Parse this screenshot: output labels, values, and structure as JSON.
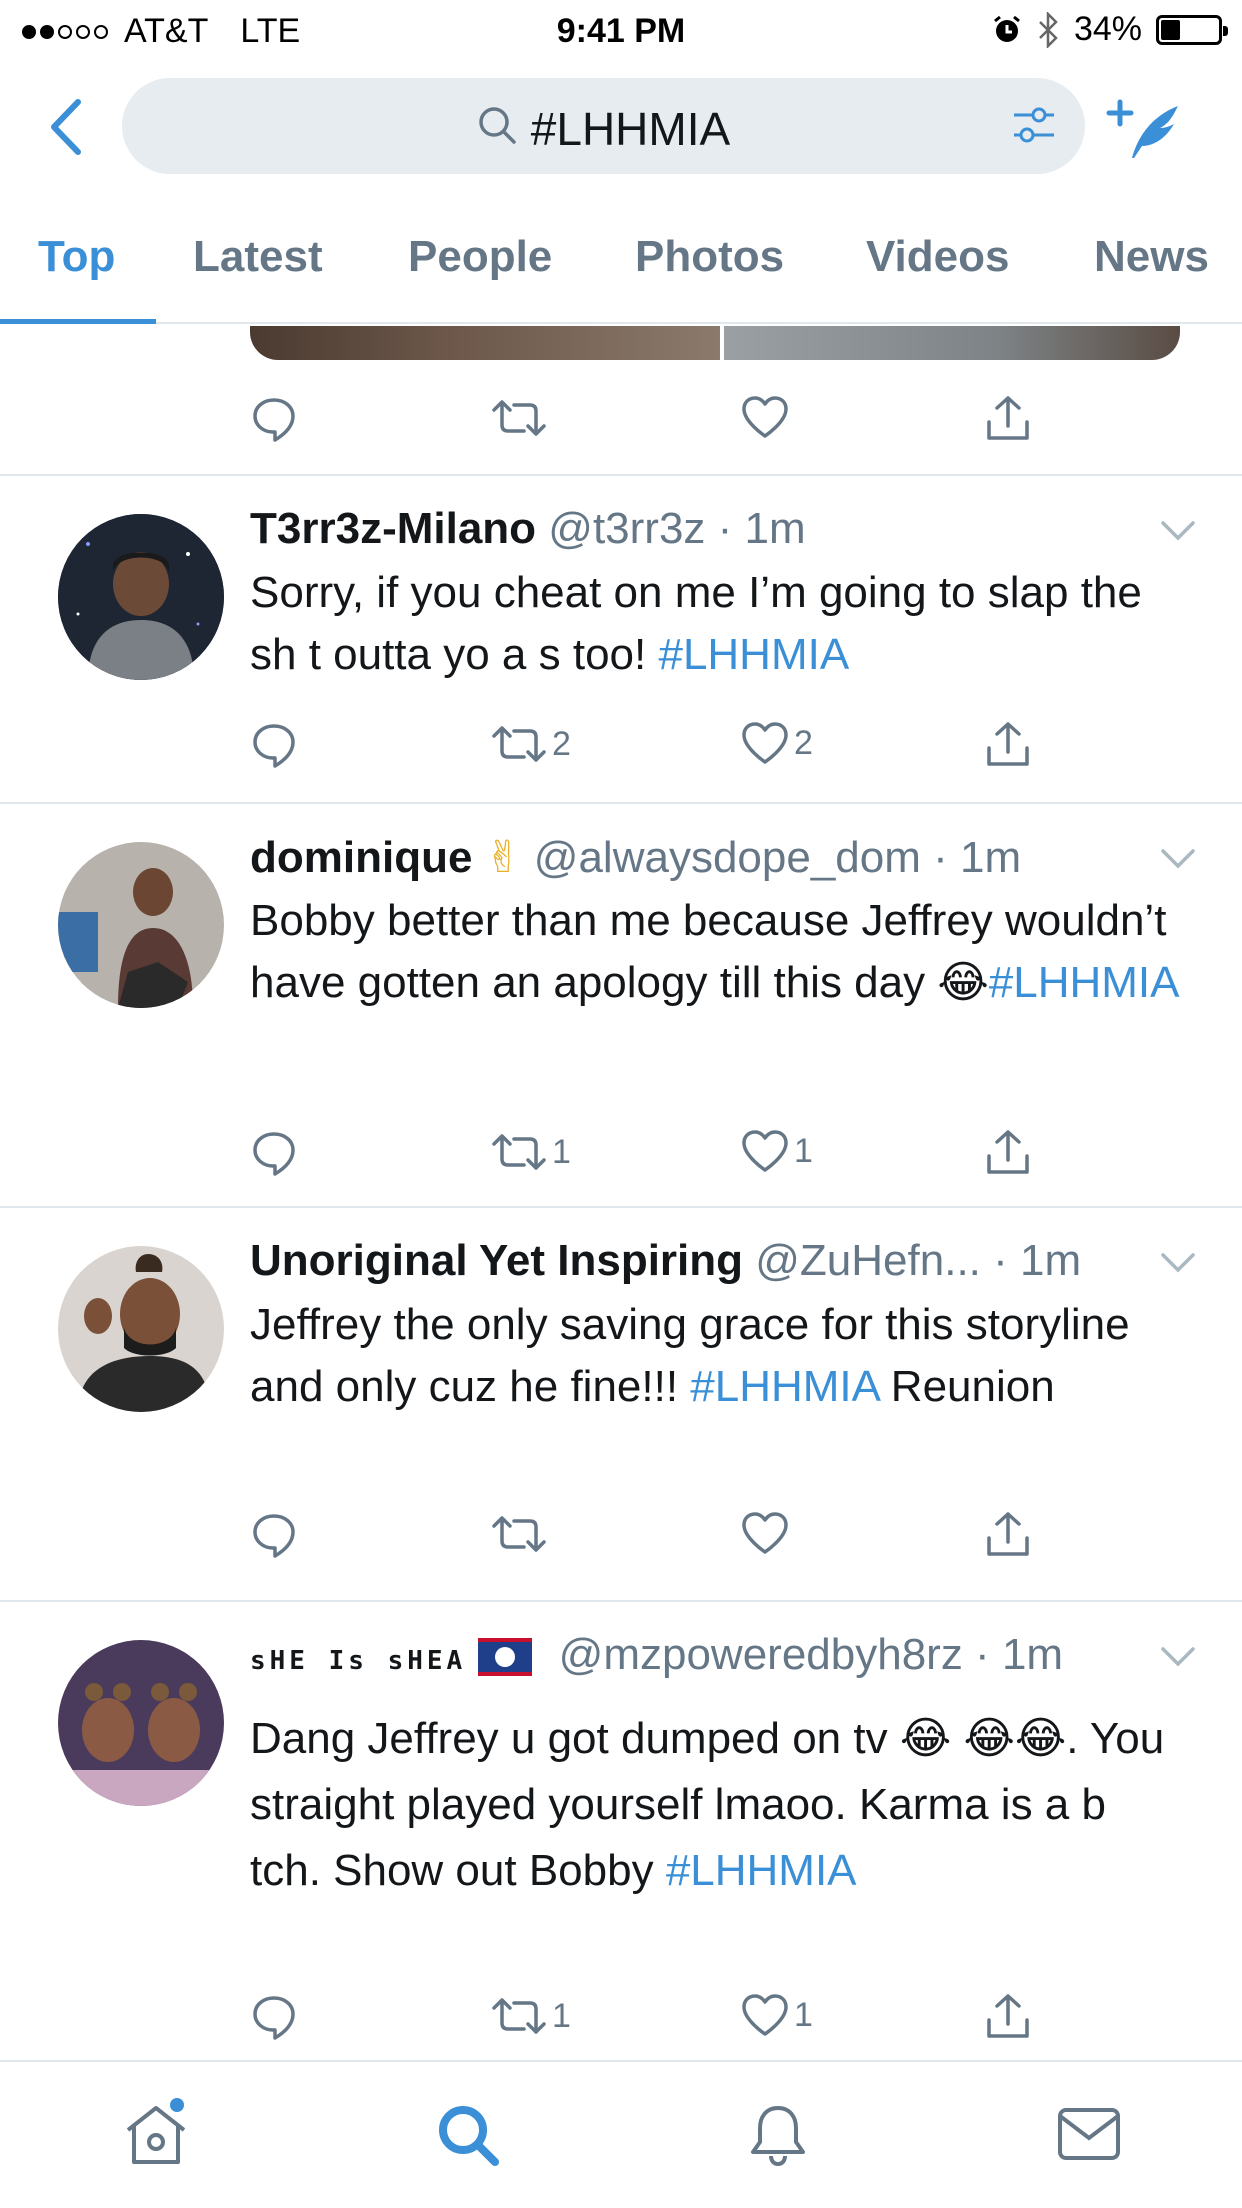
{
  "status_bar": {
    "carrier": "AT&T",
    "network": "LTE",
    "time": "9:41 PM",
    "battery_percent": "34%",
    "battery_level": 0.34,
    "signal_bars_filled": 2,
    "signal_bars_total": 5
  },
  "search": {
    "query": "#LHHMIA"
  },
  "tabs": [
    {
      "label": "Top",
      "active": true
    },
    {
      "label": "Latest",
      "active": false
    },
    {
      "label": "People",
      "active": false
    },
    {
      "label": "Photos",
      "active": false
    },
    {
      "label": "Videos",
      "active": false
    },
    {
      "label": "News",
      "active": false
    }
  ],
  "previous_tweet_actions": {
    "retweets": "",
    "likes": ""
  },
  "tweets": [
    {
      "name": "T3rr3z-Milano",
      "name_suffix": "",
      "handle": "@t3rr3z",
      "time": "1m",
      "text": "Sorry, if you cheat on me I’m going to slap the sh t outta yo a  s too! ",
      "hashtag": "#LHHMIA",
      "text_after": "",
      "retweets": "2",
      "likes": "2"
    },
    {
      "name": "dominique",
      "name_suffix": "✌",
      "handle": "@alwaysdope_dom",
      "time": "1m",
      "text": "Bobby better than me because Jeffrey wouldn’t have gotten an apology till this day 😂",
      "hashtag": "#LHHMIA",
      "text_after": "",
      "retweets": "1",
      "likes": "1"
    },
    {
      "name": "Unoriginal Yet Inspiring",
      "name_suffix": "",
      "handle": "@ZuHefn...",
      "time": "1m",
      "text": "Jeffrey the only saving grace for this storyline and only cuz he fine!!! ",
      "hashtag": "#LHHMIA",
      "text_after": " Reunion",
      "retweets": "",
      "likes": ""
    },
    {
      "name": "sHE Is sHEA",
      "name_suffix": "",
      "handle": "@mzpoweredbyh8rz",
      "time": "1m",
      "text": "Dang Jeffrey u got dumped on tv 😂 😂😂. You straight played yourself lmaoo. Karma is a b tch. Show out Bobby ",
      "hashtag": "#LHHMIA",
      "text_after": "",
      "retweets": "1",
      "likes": "1"
    }
  ],
  "colors": {
    "accent": "#3a8fd6",
    "text": "#14171a",
    "secondary": "#657786",
    "divider": "#e1e8ed",
    "search_bg": "#e6ecf0"
  },
  "icons": {
    "back": "chevron-left-icon",
    "search": "search-icon",
    "filter": "filter-icon",
    "compose": "compose-icon",
    "reply": "reply-icon",
    "retweet": "retweet-icon",
    "like": "heart-icon",
    "share": "share-icon",
    "caret": "chevron-down-icon",
    "home": "home-icon",
    "explore": "search-icon",
    "notifications": "bell-icon",
    "messages": "mail-icon"
  }
}
